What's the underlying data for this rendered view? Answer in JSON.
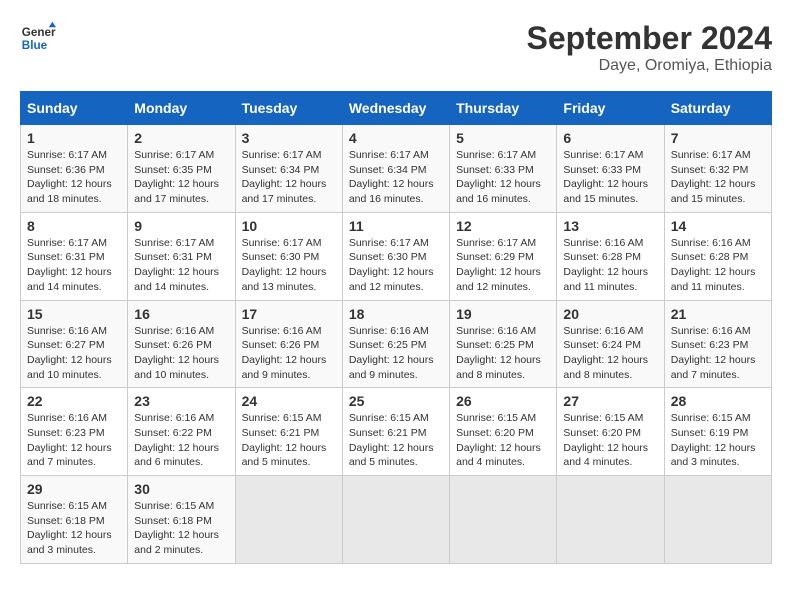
{
  "header": {
    "logo_line1": "General",
    "logo_line2": "Blue",
    "month_title": "September 2024",
    "subtitle": "Daye, Oromiya, Ethiopia"
  },
  "days_of_week": [
    "Sunday",
    "Monday",
    "Tuesday",
    "Wednesday",
    "Thursday",
    "Friday",
    "Saturday"
  ],
  "weeks": [
    [
      {
        "day": "1",
        "info": "Sunrise: 6:17 AM\nSunset: 6:36 PM\nDaylight: 12 hours\nand 18 minutes."
      },
      {
        "day": "2",
        "info": "Sunrise: 6:17 AM\nSunset: 6:35 PM\nDaylight: 12 hours\nand 17 minutes."
      },
      {
        "day": "3",
        "info": "Sunrise: 6:17 AM\nSunset: 6:34 PM\nDaylight: 12 hours\nand 17 minutes."
      },
      {
        "day": "4",
        "info": "Sunrise: 6:17 AM\nSunset: 6:34 PM\nDaylight: 12 hours\nand 16 minutes."
      },
      {
        "day": "5",
        "info": "Sunrise: 6:17 AM\nSunset: 6:33 PM\nDaylight: 12 hours\nand 16 minutes."
      },
      {
        "day": "6",
        "info": "Sunrise: 6:17 AM\nSunset: 6:33 PM\nDaylight: 12 hours\nand 15 minutes."
      },
      {
        "day": "7",
        "info": "Sunrise: 6:17 AM\nSunset: 6:32 PM\nDaylight: 12 hours\nand 15 minutes."
      }
    ],
    [
      {
        "day": "8",
        "info": "Sunrise: 6:17 AM\nSunset: 6:31 PM\nDaylight: 12 hours\nand 14 minutes."
      },
      {
        "day": "9",
        "info": "Sunrise: 6:17 AM\nSunset: 6:31 PM\nDaylight: 12 hours\nand 14 minutes."
      },
      {
        "day": "10",
        "info": "Sunrise: 6:17 AM\nSunset: 6:30 PM\nDaylight: 12 hours\nand 13 minutes."
      },
      {
        "day": "11",
        "info": "Sunrise: 6:17 AM\nSunset: 6:30 PM\nDaylight: 12 hours\nand 12 minutes."
      },
      {
        "day": "12",
        "info": "Sunrise: 6:17 AM\nSunset: 6:29 PM\nDaylight: 12 hours\nand 12 minutes."
      },
      {
        "day": "13",
        "info": "Sunrise: 6:16 AM\nSunset: 6:28 PM\nDaylight: 12 hours\nand 11 minutes."
      },
      {
        "day": "14",
        "info": "Sunrise: 6:16 AM\nSunset: 6:28 PM\nDaylight: 12 hours\nand 11 minutes."
      }
    ],
    [
      {
        "day": "15",
        "info": "Sunrise: 6:16 AM\nSunset: 6:27 PM\nDaylight: 12 hours\nand 10 minutes."
      },
      {
        "day": "16",
        "info": "Sunrise: 6:16 AM\nSunset: 6:26 PM\nDaylight: 12 hours\nand 10 minutes."
      },
      {
        "day": "17",
        "info": "Sunrise: 6:16 AM\nSunset: 6:26 PM\nDaylight: 12 hours\nand 9 minutes."
      },
      {
        "day": "18",
        "info": "Sunrise: 6:16 AM\nSunset: 6:25 PM\nDaylight: 12 hours\nand 9 minutes."
      },
      {
        "day": "19",
        "info": "Sunrise: 6:16 AM\nSunset: 6:25 PM\nDaylight: 12 hours\nand 8 minutes."
      },
      {
        "day": "20",
        "info": "Sunrise: 6:16 AM\nSunset: 6:24 PM\nDaylight: 12 hours\nand 8 minutes."
      },
      {
        "day": "21",
        "info": "Sunrise: 6:16 AM\nSunset: 6:23 PM\nDaylight: 12 hours\nand 7 minutes."
      }
    ],
    [
      {
        "day": "22",
        "info": "Sunrise: 6:16 AM\nSunset: 6:23 PM\nDaylight: 12 hours\nand 7 minutes."
      },
      {
        "day": "23",
        "info": "Sunrise: 6:16 AM\nSunset: 6:22 PM\nDaylight: 12 hours\nand 6 minutes."
      },
      {
        "day": "24",
        "info": "Sunrise: 6:15 AM\nSunset: 6:21 PM\nDaylight: 12 hours\nand 5 minutes."
      },
      {
        "day": "25",
        "info": "Sunrise: 6:15 AM\nSunset: 6:21 PM\nDaylight: 12 hours\nand 5 minutes."
      },
      {
        "day": "26",
        "info": "Sunrise: 6:15 AM\nSunset: 6:20 PM\nDaylight: 12 hours\nand 4 minutes."
      },
      {
        "day": "27",
        "info": "Sunrise: 6:15 AM\nSunset: 6:20 PM\nDaylight: 12 hours\nand 4 minutes."
      },
      {
        "day": "28",
        "info": "Sunrise: 6:15 AM\nSunset: 6:19 PM\nDaylight: 12 hours\nand 3 minutes."
      }
    ],
    [
      {
        "day": "29",
        "info": "Sunrise: 6:15 AM\nSunset: 6:18 PM\nDaylight: 12 hours\nand 3 minutes."
      },
      {
        "day": "30",
        "info": "Sunrise: 6:15 AM\nSunset: 6:18 PM\nDaylight: 12 hours\nand 2 minutes."
      },
      {
        "day": "",
        "info": ""
      },
      {
        "day": "",
        "info": ""
      },
      {
        "day": "",
        "info": ""
      },
      {
        "day": "",
        "info": ""
      },
      {
        "day": "",
        "info": ""
      }
    ]
  ]
}
